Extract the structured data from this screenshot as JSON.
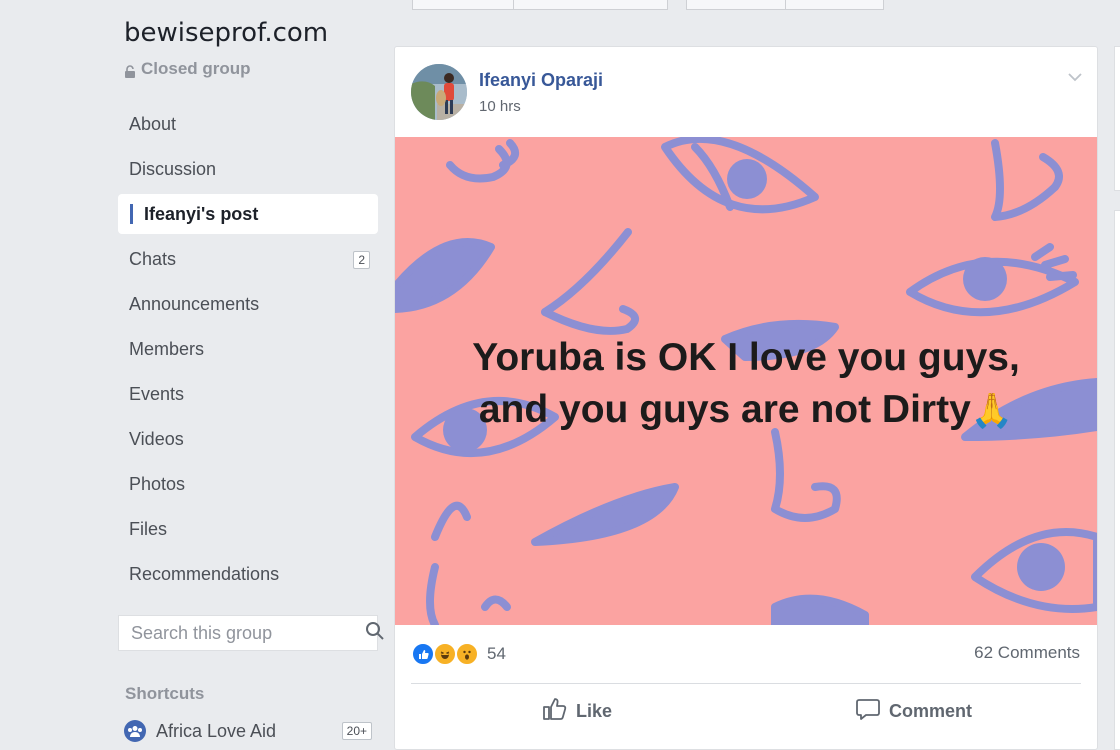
{
  "group": {
    "name": "bewiseprof.com",
    "type": "Closed group"
  },
  "nav": [
    {
      "label": "About"
    },
    {
      "label": "Discussion"
    },
    {
      "label": "Ifeanyi's post",
      "active": true
    },
    {
      "label": "Chats",
      "count": "2"
    },
    {
      "label": "Announcements"
    },
    {
      "label": "Members"
    },
    {
      "label": "Events"
    },
    {
      "label": "Videos"
    },
    {
      "label": "Photos"
    },
    {
      "label": "Files"
    },
    {
      "label": "Recommendations"
    }
  ],
  "search": {
    "placeholder": "Search this group"
  },
  "shortcuts": {
    "heading": "Shortcuts",
    "items": [
      {
        "label": "Africa Love Aid",
        "count": "20+"
      }
    ]
  },
  "post": {
    "author": "Ifeanyi Oparaji",
    "time": "10 hrs",
    "text_line1": "Yoruba is OK I love you guys,",
    "text_line2": "and you guys are not Dirty",
    "emoji": "🙏",
    "reaction_count": "54",
    "comments": "62 Comments",
    "like_label": "Like",
    "comment_label": "Comment"
  },
  "colors": {
    "link": "#385898",
    "brand": "#4267b2",
    "art_background": "#fba3a1",
    "art_lines": "#8c8fd3"
  }
}
